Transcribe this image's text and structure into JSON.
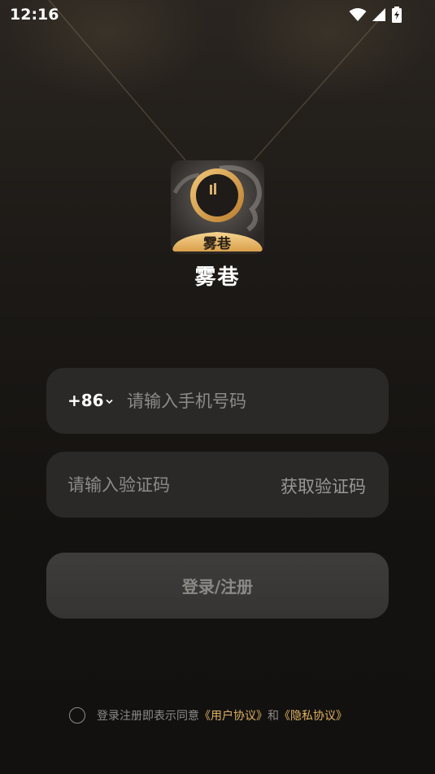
{
  "status_bar": {
    "time": "12:16",
    "icons": [
      "wifi-icon",
      "cellular-signal-icon",
      "battery-charging-icon"
    ]
  },
  "app": {
    "name": "雾巷",
    "logo_text": "雾巷",
    "brand_color": "#e0b15e"
  },
  "phone": {
    "country_code": "+86",
    "placeholder": "请输入手机号码",
    "value": ""
  },
  "verification": {
    "placeholder": "请输入验证码",
    "value": "",
    "get_code_label": "获取验证码"
  },
  "login": {
    "button_label": "登录/注册"
  },
  "agreement": {
    "checked": false,
    "prefix": "登录注册即表示同意",
    "user_agreement": "《用户协议》",
    "conjunction": "和",
    "privacy_policy": "《隐私协议》"
  }
}
